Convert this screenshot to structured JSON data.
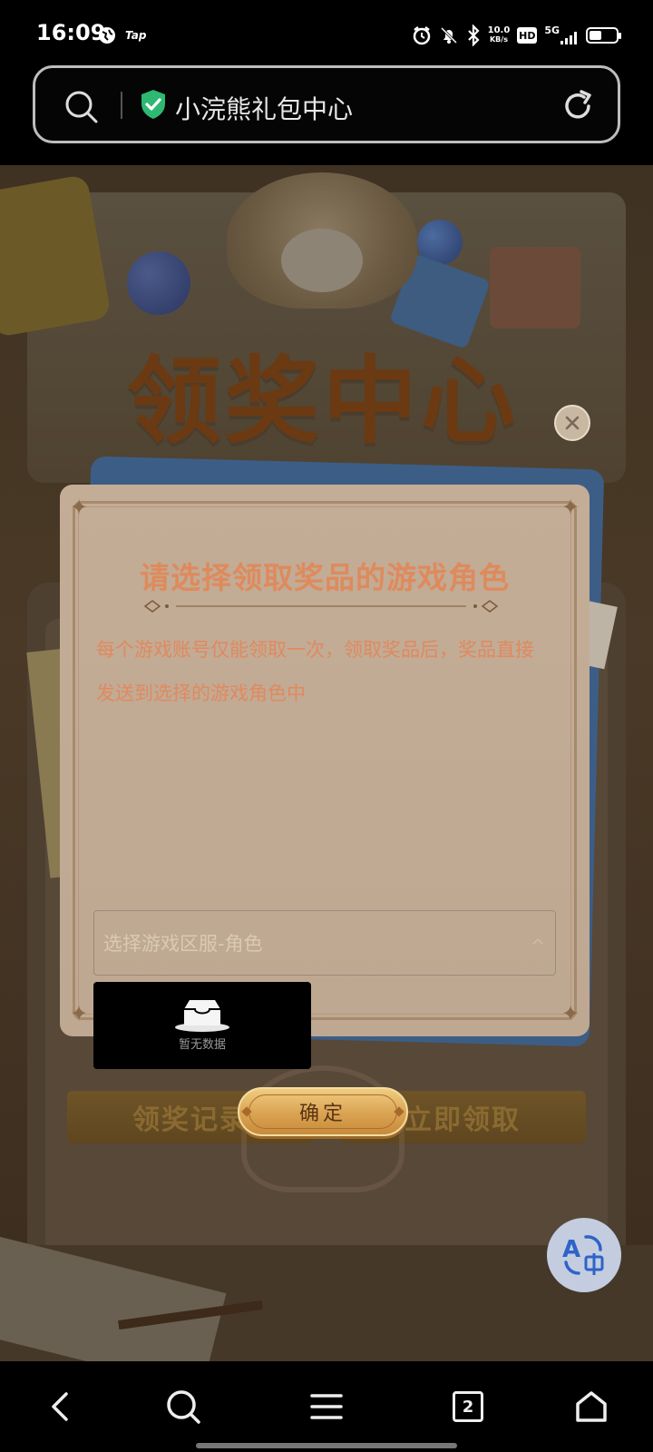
{
  "status_bar": {
    "time": "16:09",
    "tap_label": "Tap",
    "net_speed_value": "10.0",
    "net_speed_unit": "KB/s",
    "hd_label": "HD",
    "signal_label": "5G",
    "battery_level": 0.45
  },
  "address_bar": {
    "title": "小浣熊礼包中心",
    "secure_color": "#2eb872"
  },
  "page": {
    "headline": "领奖中心",
    "buttons": {
      "records_label": "领奖记录",
      "claim_now_label": "立即领取"
    }
  },
  "modal": {
    "title": "请选择领取奖品的游戏角色",
    "description": "每个游戏账号仅能领取一次，领取奖品后，奖品直接 发送到选择的游戏角色中",
    "select": {
      "placeholder": "选择游戏区服-角色"
    },
    "dropdown": {
      "empty_text": "暂无数据"
    },
    "confirm_label": "确定",
    "accent_color": "#e1895e"
  },
  "floating": {
    "translate_icon": "translate-icon"
  },
  "bottom_nav": {
    "tab_count": "2",
    "items": [
      "back-icon",
      "search-icon",
      "menu-icon",
      "tabs-icon",
      "home-icon"
    ]
  }
}
